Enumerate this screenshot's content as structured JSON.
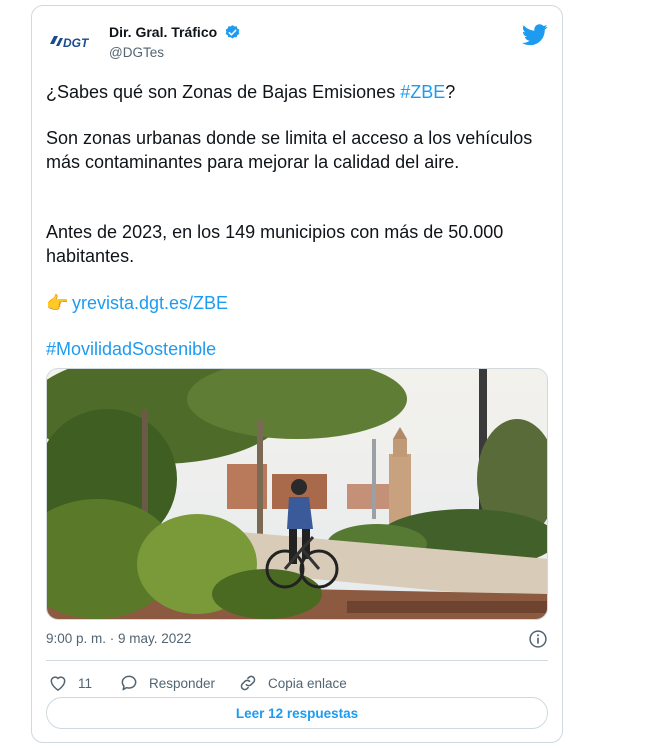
{
  "account": {
    "name": "Dir. Gral. Tráfico",
    "handle": "@DGTes",
    "logo_text": "DGT",
    "verified_icon": "verified-badge-icon",
    "brand_icon": "twitter-bird-icon"
  },
  "tweet": {
    "line1_prefix": "¿Sabes qué son Zonas de Bajas Emisiones ",
    "line1_hashtag": "#ZBE",
    "line1_suffix": "?",
    "paragraph2": "Son zonas urbanas donde se limita el acceso a los vehículos más contaminantes para mejorar la calidad del aire.",
    "paragraph3": "Antes de 2023, en los 149 municipios con más de 50.000 habitantes.",
    "link_emoji": "👉",
    "link": "yrevista.dgt.es/ZBE",
    "hashtag": "#MovilidadSostenible"
  },
  "meta": {
    "timestamp": "9:00 p. m. · 9 may. 2022",
    "info_icon": "info-icon"
  },
  "actions": {
    "likes": "11",
    "reply_label": "Responder",
    "copy_label": "Copia enlace"
  },
  "replies_button": "Leer 12 respuestas",
  "colors": {
    "accent": "#1d9bf0",
    "text": "#0f1419",
    "secondary": "#536471",
    "border": "#cfd9de"
  }
}
